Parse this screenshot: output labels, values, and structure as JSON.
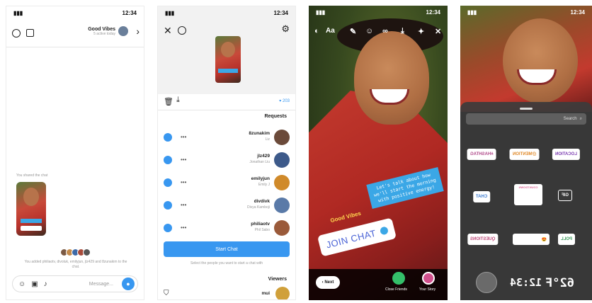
{
  "colors": {
    "accent": "#3897f0",
    "sticker_blue": "#3ba7e6",
    "join_text": "#4a63d6"
  },
  "phone1": {
    "status_time": "12:34",
    "title": "Good Vibes",
    "subtitle": "5 active today",
    "shared_note": "You shared the chat",
    "footer_text": "You added philiaotv, divoluk, emilyjun, jlz429 and 8zunakim to the chat.",
    "composer_placeholder": "Message...",
    "icons": [
      "info-icon",
      "video-icon",
      "chevron-right-icon",
      "sticker-icon",
      "gallery-icon",
      "mic-icon",
      "camera-icon"
    ]
  },
  "phone2": {
    "status_time": "12:34",
    "viewer_count": "203",
    "requests_header": "Requests",
    "requests": [
      {
        "name": "8zunakim",
        "sub": "Liz"
      },
      {
        "name": "jlz429",
        "sub": "Jonathan Liu"
      },
      {
        "name": "emilyjun",
        "sub": "Emily J"
      },
      {
        "name": "divdivk",
        "sub": "Divya Kamboji"
      },
      {
        "name": "philiaotv",
        "sub": "Phil Sabo"
      }
    ],
    "start_chat_label": "Start Chat",
    "select_hint": "Select the people you want to start a chat with",
    "viewers_header": "Viewers",
    "viewer_name": "mui"
  },
  "phone3": {
    "status_time": "12:34",
    "aa_label": "Aa",
    "sticker_text": "Let's talk about how we'll start the morning with positive energy!",
    "gv_label": "Good Vibes",
    "join_chat_label": "JOIN CHAT",
    "next_label": "Next",
    "close_friends_label": "Close Friends",
    "your_story_label": "Your Story"
  },
  "phone4": {
    "status_time": "12:34",
    "search_placeholder": "Search",
    "stickers": {
      "location": "LOCATION",
      "mention": "@MENTION",
      "hashtag": "#HASHTAG",
      "gif": "GIF",
      "chat": "CHAT",
      "countdown": "COUNTDOWN",
      "poll": "POLL",
      "questions": "QUESTIONS",
      "slider_emoji": "😍"
    },
    "temp": "62°F",
    "time_sticker": "12:34"
  }
}
